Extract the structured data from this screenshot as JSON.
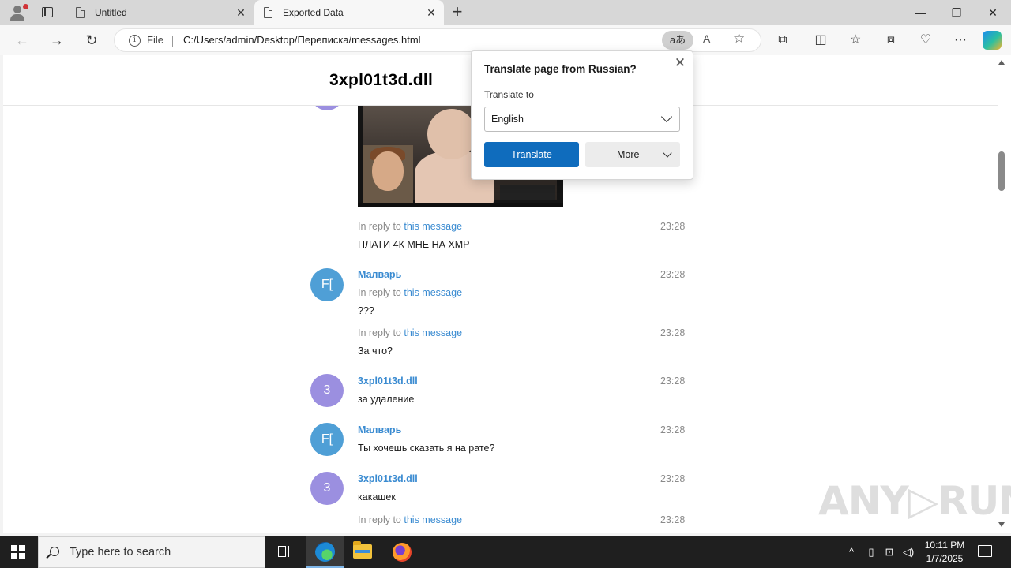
{
  "browser": {
    "tabs": [
      {
        "title": "Untitled",
        "close": "✕"
      },
      {
        "title": "Exported Data",
        "close": "✕"
      }
    ],
    "new_tab": "+",
    "window_controls": {
      "minimize": "—",
      "maximize": "❐",
      "close": "✕"
    },
    "nav": {
      "back": "←",
      "forward": "→",
      "refresh": "↻"
    },
    "address": {
      "scheme_label": "File",
      "info_glyph": "i",
      "url": "C:/Users/admin/Desktop/Переписка/messages.html",
      "translate_glyph": "aあ",
      "read_aloud_glyph": "A",
      "favorite_glyph": "☆"
    },
    "toolbar_icons": {
      "extensions": "⧉",
      "split": "◫",
      "favorites": "☆",
      "collections": "⧈",
      "performance": "♡",
      "menu": "···"
    }
  },
  "page": {
    "title": "3xpl01t3d.dll",
    "messages": {
      "m1": {
        "reply_prefix": "In reply to ",
        "reply_link": "this message",
        "time": "23:28",
        "text": "ПЛАТИ 4К МНЕ НА XMP"
      },
      "m2": {
        "avatar": "F[",
        "name": "Малварь",
        "time": "23:28",
        "reply_prefix": "In reply to ",
        "reply_link": "this message",
        "text": "???"
      },
      "m3": {
        "reply_prefix": "In reply to ",
        "reply_link": "this message",
        "time": "23:28",
        "text": "За что?"
      },
      "m4": {
        "avatar": "3",
        "name": "3xpl01t3d.dll",
        "time": "23:28",
        "text": "за удаление"
      },
      "m5": {
        "avatar": "F[",
        "name": "Малварь",
        "time": "23:28",
        "text": "Ты хочешь сказать я на рате?"
      },
      "m6": {
        "avatar": "3",
        "name": "3xpl01t3d.dll",
        "time": "23:28",
        "text": "какашек"
      },
      "m7": {
        "reply_prefix": "In reply to ",
        "reply_link": "this message",
        "time": "23:28"
      }
    }
  },
  "translate_popup": {
    "title": "Translate page from Russian?",
    "close": "✕",
    "label": "Translate to",
    "selected_language": "English",
    "translate_button": "Translate",
    "more_button": "More"
  },
  "watermark": "ANY▷RUN",
  "taskbar": {
    "search_placeholder": "Type here to search",
    "tray": {
      "chevron": "^",
      "time": "10:11 PM",
      "date": "1/7/2025"
    }
  },
  "colors": {
    "accent": "#0f6cbd",
    "link": "#3a8bd1",
    "avatar_purple": "#9b8fe0",
    "avatar_blue": "#4f9fd6"
  }
}
